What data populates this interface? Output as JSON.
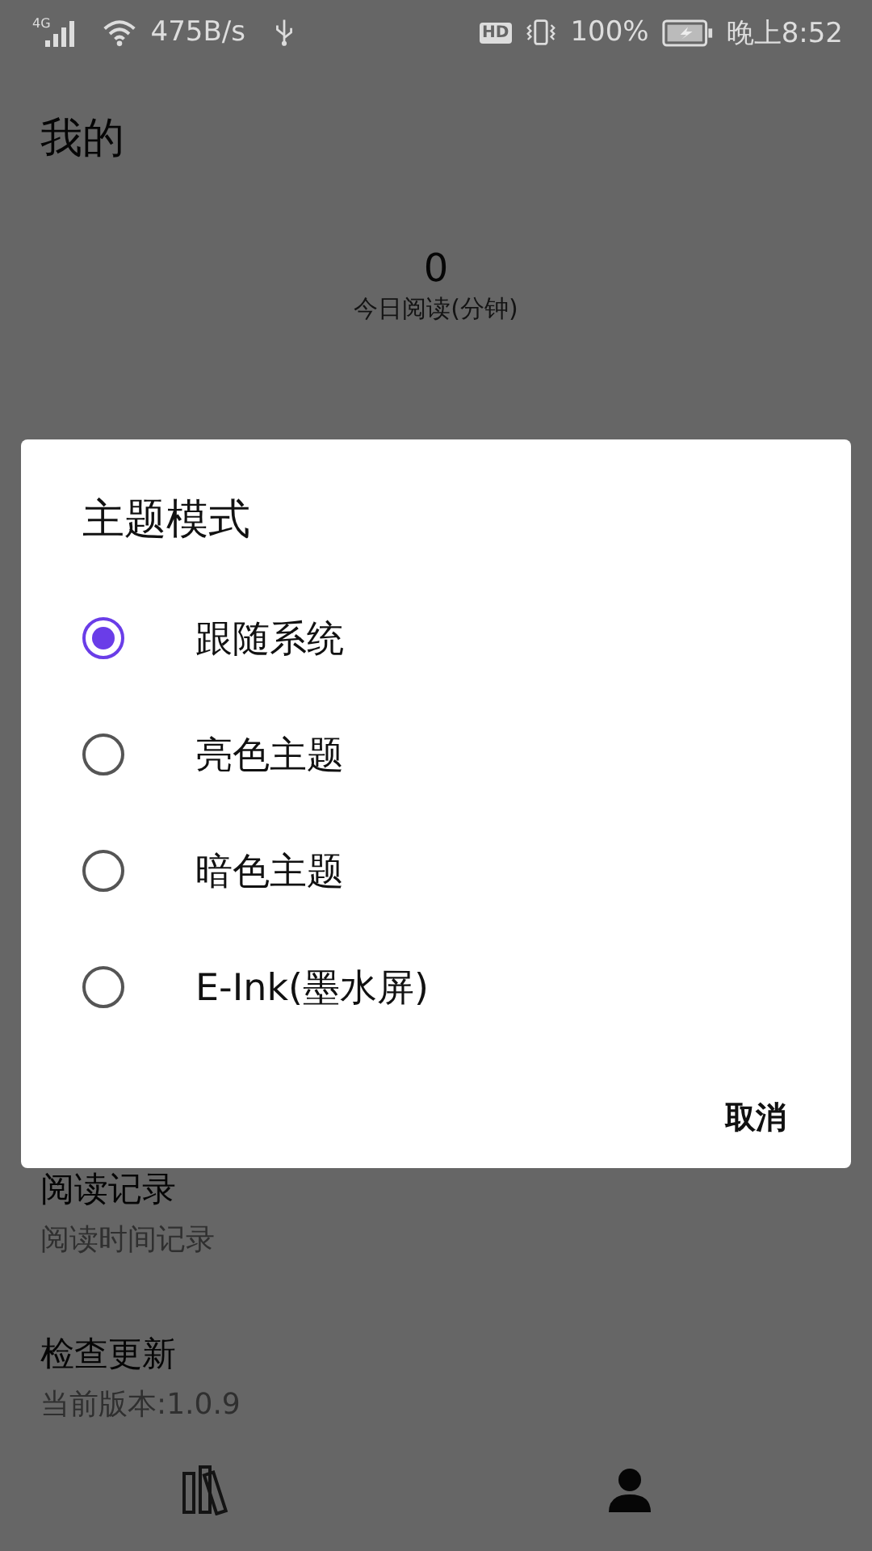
{
  "status_bar": {
    "network": "4G",
    "speed": "475B/s",
    "hd": "HD",
    "battery": "100%",
    "time": "晚上8:52"
  },
  "header": {
    "title": "我的"
  },
  "stats": {
    "value": "0",
    "label": "今日阅读(分钟)"
  },
  "settings": [
    {
      "title": "阅读记录",
      "subtitle": "阅读时间记录"
    },
    {
      "title": "检查更新",
      "subtitle": "当前版本:1.0.9"
    }
  ],
  "dialog": {
    "title": "主题模式",
    "options": [
      {
        "label": "跟随系统",
        "selected": true
      },
      {
        "label": "亮色主题",
        "selected": false
      },
      {
        "label": "暗色主题",
        "selected": false
      },
      {
        "label": "E-Ink(墨水屏)",
        "selected": false
      }
    ],
    "cancel": "取消"
  }
}
